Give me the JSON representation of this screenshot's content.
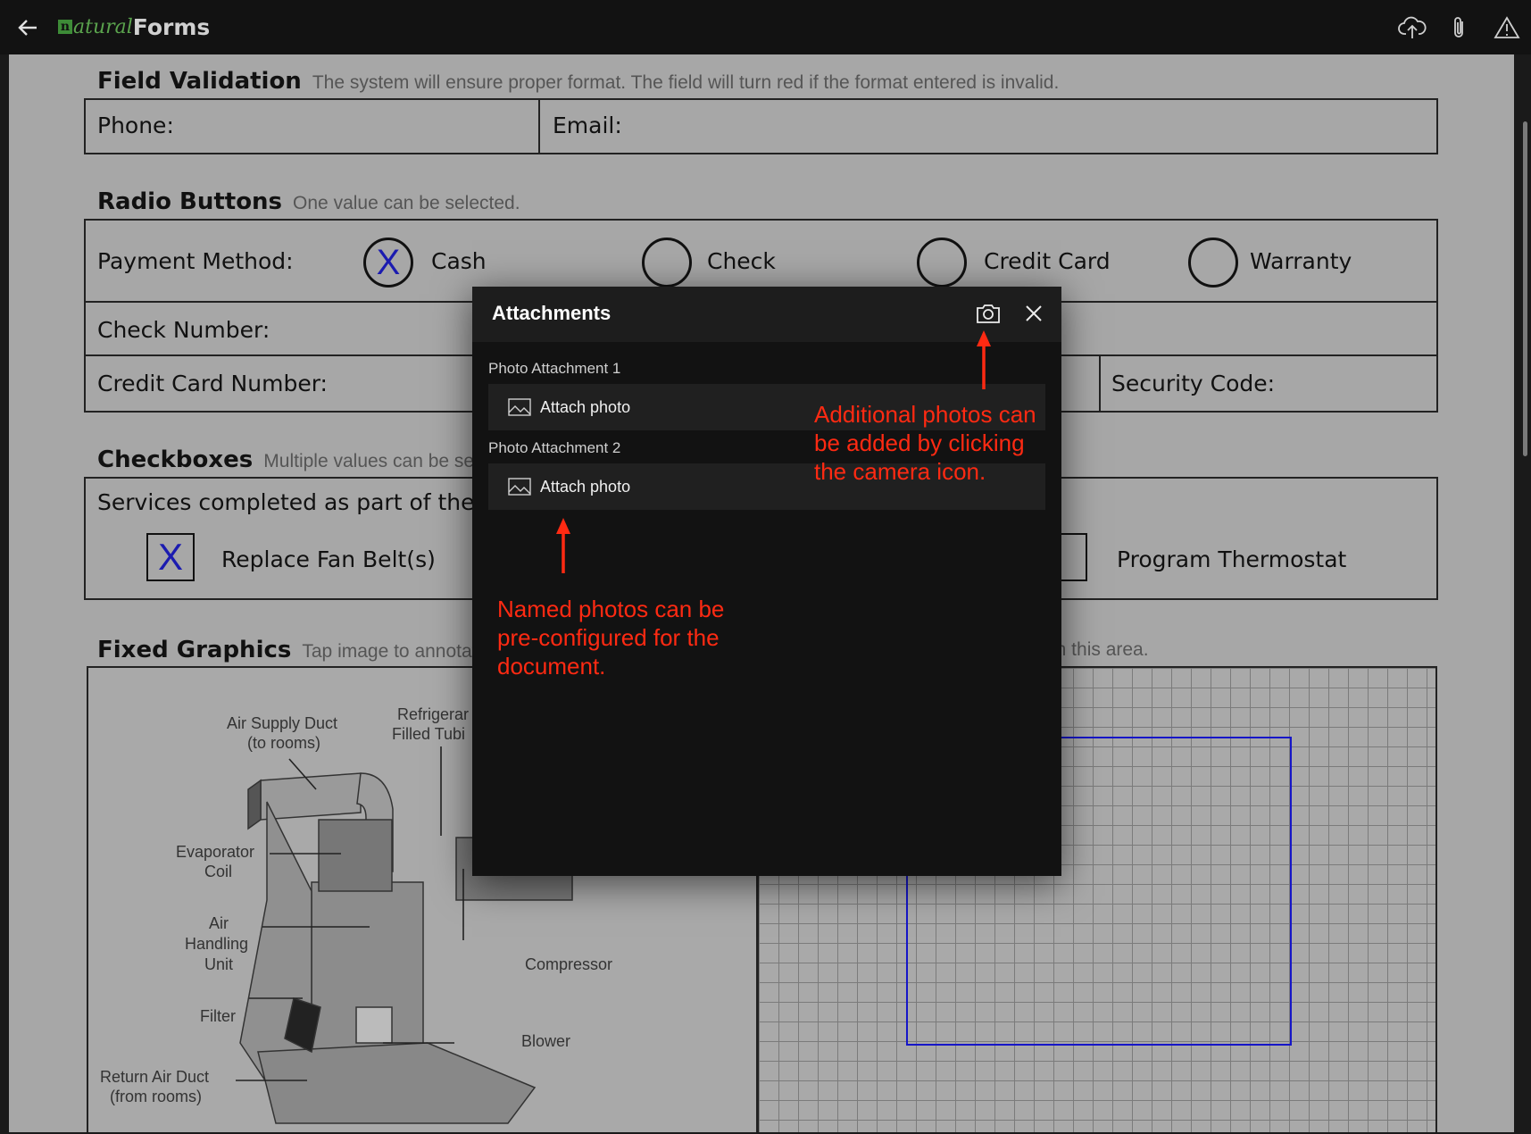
{
  "app": {
    "logo_n": "n",
    "logo_natural": "atural",
    "logo_forms": "Forms",
    "icons": [
      "back-arrow-icon",
      "cloud-upload-icon",
      "paperclip-icon",
      "warning-icon"
    ]
  },
  "form": {
    "field_validation": {
      "title": "Field Validation",
      "desc": "The system will ensure proper format. The field will turn red if the format entered is invalid.",
      "phone_label": "Phone:",
      "email_label": "Email:"
    },
    "radio": {
      "title": "Radio Buttons",
      "desc": "One value can be selected.",
      "payment_label": "Payment Method:",
      "options": [
        {
          "label": "Cash",
          "mark": "X"
        },
        {
          "label": "Check",
          "mark": ""
        },
        {
          "label": "Credit Card",
          "mark": ""
        },
        {
          "label": "Warranty",
          "mark": ""
        }
      ],
      "check_number_label": "Check Number:",
      "credit_card_label": "Credit Card Number:",
      "security_code_label": "Security Code:"
    },
    "checkboxes": {
      "title": "Checkboxes",
      "desc": "Multiple values can be selec",
      "services_label": "Services completed as part of the",
      "items": [
        {
          "label": "Replace Fan Belt(s)",
          "mark": "X"
        },
        {
          "label": "Program Thermostat",
          "mark": ""
        }
      ]
    },
    "fixed_graphics": {
      "title": "Fixed Graphics",
      "desc": "Tap image to annotate.",
      "desc_right": "in this area.",
      "diagram_labels": {
        "air_supply": "Air Supply Duct",
        "air_supply_sub": "(to rooms)",
        "refrigerant": "Refrigerar",
        "refrigerant_sub": "Filled Tubi",
        "evaporator": "Evaporator",
        "evaporator_sub": "Coil",
        "air_handling_1": "Air",
        "air_handling_2": "Handling",
        "air_handling_3": "Unit",
        "filter": "Filter",
        "return_air": "Return Air Duct",
        "return_air_sub": "(from rooms)",
        "compressor": "Compressor",
        "blower": "Blower"
      }
    }
  },
  "modal": {
    "title": "Attachments",
    "icons": [
      "camera-icon",
      "close-icon"
    ],
    "attachments": [
      {
        "name": "Photo Attachment 1",
        "action": "Attach photo"
      },
      {
        "name": "Photo Attachment 2",
        "action": "Attach photo"
      }
    ]
  },
  "annotations": {
    "camera_note": [
      "Additional photos can",
      "be added by clicking",
      "the camera icon."
    ],
    "named_note": [
      "Named photos can be",
      "pre-configured for the",
      "document."
    ],
    "color": "#ff2a12"
  }
}
